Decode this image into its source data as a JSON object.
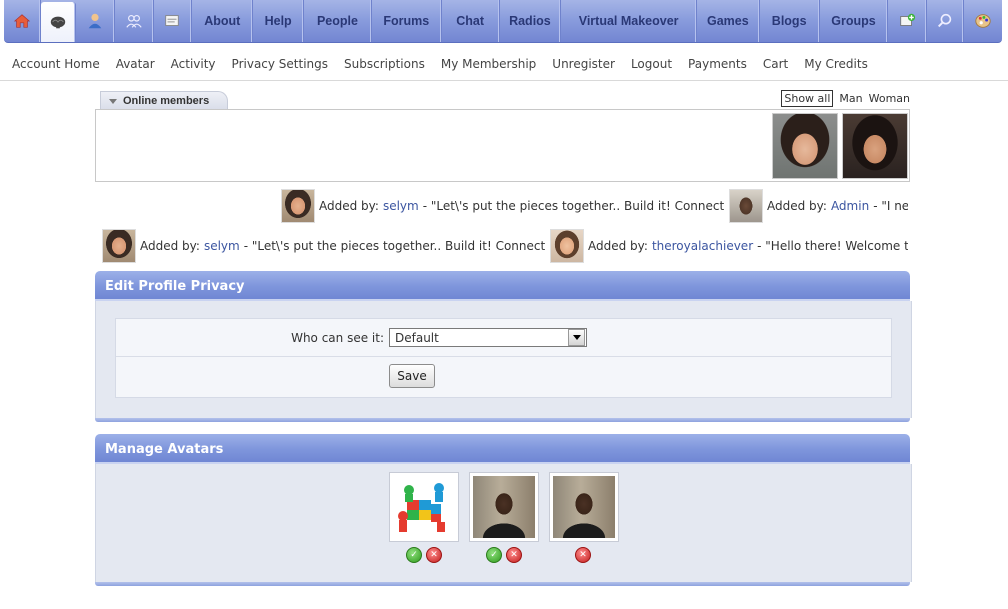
{
  "topnav": {
    "icons": [
      "home-icon",
      "brain-icon",
      "user-icon",
      "people-icon",
      "messages-icon"
    ],
    "items": [
      "About",
      "Help",
      "People",
      "Forums",
      "Chat",
      "Radios",
      "Virtual Makeover",
      "Games",
      "Blogs",
      "Groups"
    ],
    "right_icons": [
      "add-icon",
      "search-icon",
      "palette-icon"
    ]
  },
  "subnav": {
    "items": [
      "Account Home",
      "Avatar",
      "Activity",
      "Privacy Settings",
      "Subscriptions",
      "My Membership",
      "Unregister",
      "Logout",
      "Payments",
      "Cart",
      "My Credits"
    ]
  },
  "online": {
    "tab_label": "Online members",
    "filters": [
      "Show all",
      "Man",
      "Woman"
    ]
  },
  "activity": {
    "added_by_label": "Added by:",
    "row1": [
      {
        "user": "selym",
        "text": "- \"Let\\'s put the pieces together.. Build it! Connect it!\""
      },
      {
        "user": "Admin",
        "text": "- \"I ne"
      }
    ],
    "row2": [
      {
        "user": "selym",
        "text": "- \"Let\\'s put the pieces together.. Build it! Connect it!\""
      },
      {
        "user": "theroyalachiever",
        "text": "- \"Hello there! Welcome to"
      }
    ]
  },
  "privacy_panel": {
    "title": "Edit Profile Privacy",
    "who_label": "Who can see it:",
    "select_value": "Default",
    "save_label": "Save"
  },
  "avatars_panel": {
    "title": "Manage Avatars"
  }
}
